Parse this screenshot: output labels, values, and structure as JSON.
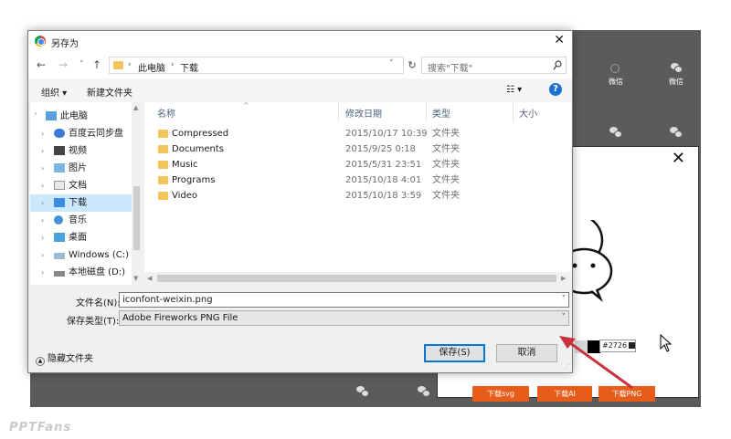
{
  "background_page": {
    "top_labels": [
      "微信",
      "微信"
    ],
    "preview_hex": "#2726",
    "download_buttons": [
      "下载svg",
      "下载AI",
      "下载PNG"
    ],
    "swatch_colors": [
      "#d8d8d8",
      "#000000"
    ],
    "accent_color": "#e85c1a",
    "arrow_color": "#c8323c"
  },
  "dialog": {
    "title": "另存为",
    "nav": {
      "back": "←",
      "forward": "→",
      "recent": "˅",
      "up": "↑"
    },
    "address": {
      "crumbs": [
        "此电脑",
        "下载"
      ]
    },
    "search": {
      "placeholder": "搜索\"下载\""
    },
    "toolbar": {
      "organize": "组织 ▾",
      "new_folder": "新建文件夹",
      "view": "☷ ▾",
      "help": "?"
    },
    "tree": [
      {
        "label": "此电脑",
        "icon": "computer-icon"
      },
      {
        "label": "百度云同步盘",
        "icon": "cloud-icon"
      },
      {
        "label": "视频",
        "icon": "video-icon"
      },
      {
        "label": "图片",
        "icon": "pictures-icon"
      },
      {
        "label": "文档",
        "icon": "documents-icon"
      },
      {
        "label": "下载",
        "icon": "download-icon",
        "selected": true
      },
      {
        "label": "音乐",
        "icon": "music-icon"
      },
      {
        "label": "桌面",
        "icon": "desktop-icon"
      },
      {
        "label": "Windows (C:)",
        "icon": "drive-icon"
      },
      {
        "label": "本地磁盘 (D:)",
        "icon": "drive-icon"
      }
    ],
    "columns": {
      "name": "名称",
      "date": "修改日期",
      "type": "类型",
      "size": "大小"
    },
    "files": [
      {
        "name": "Compressed",
        "date": "2015/10/17 10:39",
        "type": "文件夹"
      },
      {
        "name": "Documents",
        "date": "2015/9/25 0:18",
        "type": "文件夹"
      },
      {
        "name": "Music",
        "date": "2015/5/31 23:51",
        "type": "文件夹"
      },
      {
        "name": "Programs",
        "date": "2015/10/18 4:01",
        "type": "文件夹"
      },
      {
        "name": "Video",
        "date": "2015/10/18 3:59",
        "type": "文件夹"
      }
    ],
    "filename": {
      "label": "文件名(N):",
      "value": "iconfont-weixin.png"
    },
    "filetype": {
      "label": "保存类型(T):",
      "value": "Adobe Fireworks PNG File"
    },
    "hide_folders": "隐藏文件夹",
    "save_label": "保存(S)",
    "cancel_label": "取消"
  },
  "watermark": "PPTFans"
}
